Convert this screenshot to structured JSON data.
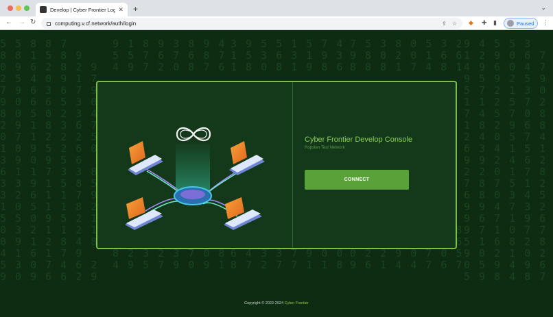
{
  "browser": {
    "tab_title": "Develop | Cyber Frontier Login",
    "url": "computing.v.cf.network/auth/login",
    "profile_label": "Paused"
  },
  "background": {
    "columns": [
      "5 5 8 8 7\n8 8 1 5 8 9\n0 9 6 2 8 2 9\n2 5 4 0 9 1 7\n7 9 6 3 6 7 9\n9 0 6 6 5 3 0\n8 0 5 0 2 3 4\n2 9 1 8 3 6 7 1\n0 7 1 2 2 2 5\n1 0 9 5 2 6 0\n3 9 0 9 5 6\n6 1 1 7 3 3 8\n3 3 9 1 5 8 5\n3 2 6 1 1 7 9\n1 0 5 1 1 8 2\n5 5 0 9 5 2 1\n0 3 2 1 1 2 1\n0 9 1 2 8 4 8\n4 1 6 1 7 9\n5 3 0 7 4 6 2\n9 0 9 6 6 2 9",
      "9 1 8 9 3 8 9 4\n5 5 7 6 7 6 8 7\n4 9 7 2 0 8 7 6\n\n\n\n\n\n\n\n\n\n\n\n\n\n6 3 1 0 2 0 9 5\n2 8 7 2 5 5 0 1\n8 2 3 2 3 7 0 8\n4 9 5 7 9 0 9 1",
      "3 9 5 5 1 5 7 4\n1 5 3 6 3 1 9 3\n1 8 0 8 1 9 8 6\n\n\n\n\n\n\n\n\n\n\n\n\n\n1 8 7 1 0 6 6 9\n5 4 6 0 3 7 9 6\n6 4 3 3 7 9 0 0\n8 7 2 7 7 1 1 8",
      "7 5 3 8 0 5 3 2\n9 8 0 2 0 1 6 6\n8 8 8 1 7 4 8 1\n\n\n\n\n\n\n\n\n\n\n\n\n\n5 7 7 9 6 0 9 8\n8 1 0 5 3 2 9 6\n0 2 2 9 0 7 0 5\n9 6 1 4 4 7 6 7",
      "9 4 5 5 3\n1 2 9 0 6 7\n4 9 6 0 4 7 7\n9 5 9 2 5 9 0\n5 7 2 1 3 0 3\n1 1 2 5 7 2 2\n7 4 5 7 0 8 9\n1 8 2 9 6 8 0\n2 4 0 5 7 4 3\n6 3 4 1 5 1 6\n9 9 2 4 6 2 9\n2 2 0 1 7 8 5\n7 8 7 5 1 2 2\n6 8 0 3 4 5 5\n9 9 4 7 3 2 6\n9 6 7 1 9 6 7\n9 7 1 0 7 7 0\n5 1 6 8 2 8 3\n9 0 2 1 0 2 7\n0 5 9 4 9 6 4\n5 9 8 4 8 7 8"
    ]
  },
  "card": {
    "title": "Cyber Frontier Develop Console",
    "subtitle": "Ropsten Test Network",
    "button_label": "CONNECT"
  },
  "footer": {
    "copyright": "Copyright © 2022-2024",
    "link": "Cyber Frontier"
  },
  "colors": {
    "accent": "#7bc043",
    "button": "#5aa13a",
    "page_bg": "#0d2c12",
    "card_bg": "#14391a"
  }
}
